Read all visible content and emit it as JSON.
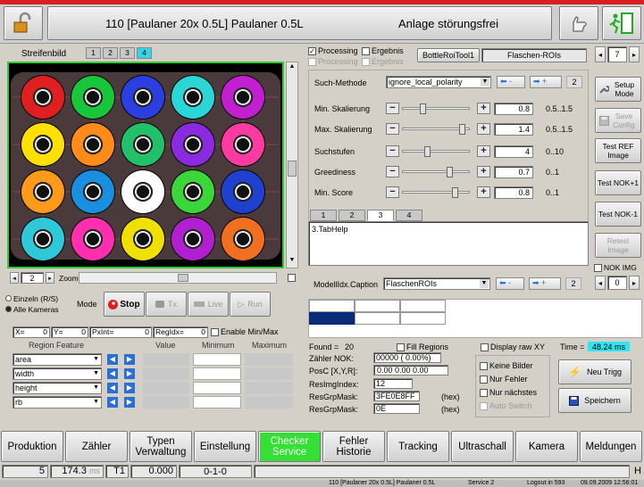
{
  "header": {
    "title": "110 [Paulaner 20x 0.5L] Paulaner 0.5L",
    "status": "Anlage störungsfrei"
  },
  "image_panel": {
    "title": "Streifenbild",
    "tabs": [
      "1",
      "2",
      "3",
      "4"
    ],
    "zoom_value": "2",
    "zoom_label": "Zoom"
  },
  "bottle_colors": [
    [
      "#e02020",
      "#19c53a",
      "#2b3fe0",
      "#2ad6d6",
      "#c21fd0"
    ],
    [
      "#ffe000",
      "#ff8c1a",
      "#22c06a",
      "#8a2be2",
      "#ff3aa0"
    ],
    [
      "#ff9a1a",
      "#1a8fe0",
      "#ffffff",
      "#3ad63a",
      "#2040d0"
    ],
    [
      "#2ec8d8",
      "#ff2fb0",
      "#f0e000",
      "#b020d0",
      "#f07020"
    ]
  ],
  "processing": {
    "processing": "Processing",
    "ergebnis": "Ergebnis",
    "processing2": "Processing",
    "ergebnis2": "Ergebnis",
    "tool": "BottleRoiTool1",
    "roi": "Flaschen-ROIs",
    "page": "7"
  },
  "params": {
    "such_methode_label": "Such-Methode",
    "such_methode_value": "ignore_local_polarity",
    "page": "2",
    "rows": [
      {
        "label": "Min. Skalierung",
        "value": "0.8",
        "range": "0.5..1.5"
      },
      {
        "label": "Max. Skalierung",
        "value": "1.4",
        "range": "0.5..1.5"
      },
      {
        "label": "Suchstufen",
        "value": "4",
        "range": "0..10"
      },
      {
        "label": "Greediness",
        "value": "0.7",
        "range": "0..1"
      },
      {
        "label": "Min. Score",
        "value": "0.8",
        "range": "0..1"
      }
    ],
    "tabs": [
      "1",
      "2",
      "3",
      "4"
    ],
    "help": "3.TabHelp"
  },
  "side_buttons": [
    "Setup Mode",
    "Save Config",
    "Test REF Image",
    "Test NOK+1",
    "Test NOK-1",
    "Retest Image"
  ],
  "nok_img": "NOK IMG",
  "nok_page": "0",
  "model": {
    "label": "ModellIdx.Caption",
    "value": "FlaschenROIs",
    "page": "2"
  },
  "left_controls": {
    "einzeln": "Einzeln (R/S)",
    "alle": "Alle Kameras",
    "mode": "Mode",
    "stop": "Stop",
    "tx": "Tx",
    "live": "Live",
    "run": "Run",
    "x": "X=",
    "x_val": "0",
    "y": "Y=",
    "y_val": "0",
    "pxlnt": "PxInt=",
    "pxlnt_val": "0",
    "regidx": "RegIdx=",
    "regidx_val": "0",
    "enable_minmax": "Enable Min/Max"
  },
  "region": {
    "headers": [
      "Region Feature",
      "Value",
      "Minimum",
      "Maximum"
    ],
    "rows": [
      "area",
      "width",
      "height",
      "rb"
    ]
  },
  "results": {
    "found_label": "Found =",
    "found": "20",
    "fill_regions": "Fill Regions",
    "display_raw": "Display raw XY",
    "time_label": "Time =",
    "time": "48.24 ms",
    "zahler_label": "Zähler NOK:",
    "zahler": "00000 ( 0.00%)",
    "posc_label": "PosC [X,Y,R]:",
    "posc": "0.00   0.00   0.00",
    "resimg_label": "ResImgIndex:",
    "resimg": "12",
    "resgrp1_label": "ResGrpMask:",
    "resgrp1": "3FE0E8FF",
    "resgrp2_label": "ResGrpMask:",
    "resgrp2": "0E",
    "hex": "(hex)",
    "keine_bilder": "Keine Bilder",
    "nur_fehler": "Nur Fehler",
    "nur_nachstes": "Nur nächstes",
    "auto_switch": "Auto Switch",
    "neu_trigg": "Neu Trigg",
    "speichern": "Speichern"
  },
  "nav": [
    "Produktion",
    "Zähler",
    "Typen Verwaltung",
    "Einstellung",
    "Checker Service",
    "Fehler Historie",
    "Tracking",
    "Ultraschall",
    "Kamera",
    "Meldungen"
  ],
  "statusbar": {
    "a": "5",
    "b": "174.3",
    "unit": "ms",
    "t1": "T1",
    "c": "0.000",
    "d": "0-1-0",
    "h": "H"
  },
  "footer": {
    "f1": "110 [Paulaner 20x 0.5L] Paulaner 0.5L",
    "f2": "Service 2",
    "f3": "Logout in 593",
    "f4": "09.09.2009 12:56:01"
  }
}
